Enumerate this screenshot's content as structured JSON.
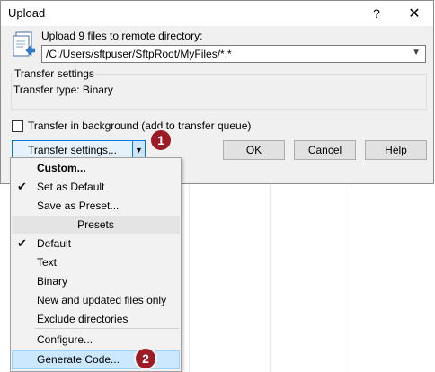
{
  "window": {
    "title": "Upload",
    "help_glyph": "?",
    "close_glyph": "✕"
  },
  "upload": {
    "label": "Upload 9 files to remote directory:",
    "directory_value": "/C:/Users/sftpuser/SftpRoot/MyFiles/*.*"
  },
  "transfer_settings_group": {
    "legend": "Transfer settings",
    "text": "Transfer type: Binary"
  },
  "background_checkbox": {
    "label": "Transfer in background (add to transfer queue)",
    "checked": false
  },
  "buttons": {
    "transfer_settings": "Transfer settings...",
    "ok": "OK",
    "cancel": "Cancel",
    "help": "Help"
  },
  "badges": {
    "one": "1",
    "two": "2"
  },
  "menu": {
    "items_top": [
      {
        "label": "Custom...",
        "bold": true,
        "checked": false
      },
      {
        "label": "Set as Default",
        "checked": true
      },
      {
        "label": "Save as Preset...",
        "checked": false
      }
    ],
    "presets_header": "Presets",
    "presets": [
      {
        "label": "Default",
        "checked": true
      },
      {
        "label": "Text",
        "checked": false
      },
      {
        "label": "Binary",
        "checked": false
      },
      {
        "label": "New and updated files only",
        "checked": false
      },
      {
        "label": "Exclude directories",
        "checked": false
      }
    ],
    "configure": "Configure...",
    "generate_code": "Generate Code...",
    "check_glyph": "✔"
  },
  "colors": {
    "badge": "#9b1c24",
    "accent": "#0078d7",
    "menu_highlight": "#cce8ff"
  }
}
